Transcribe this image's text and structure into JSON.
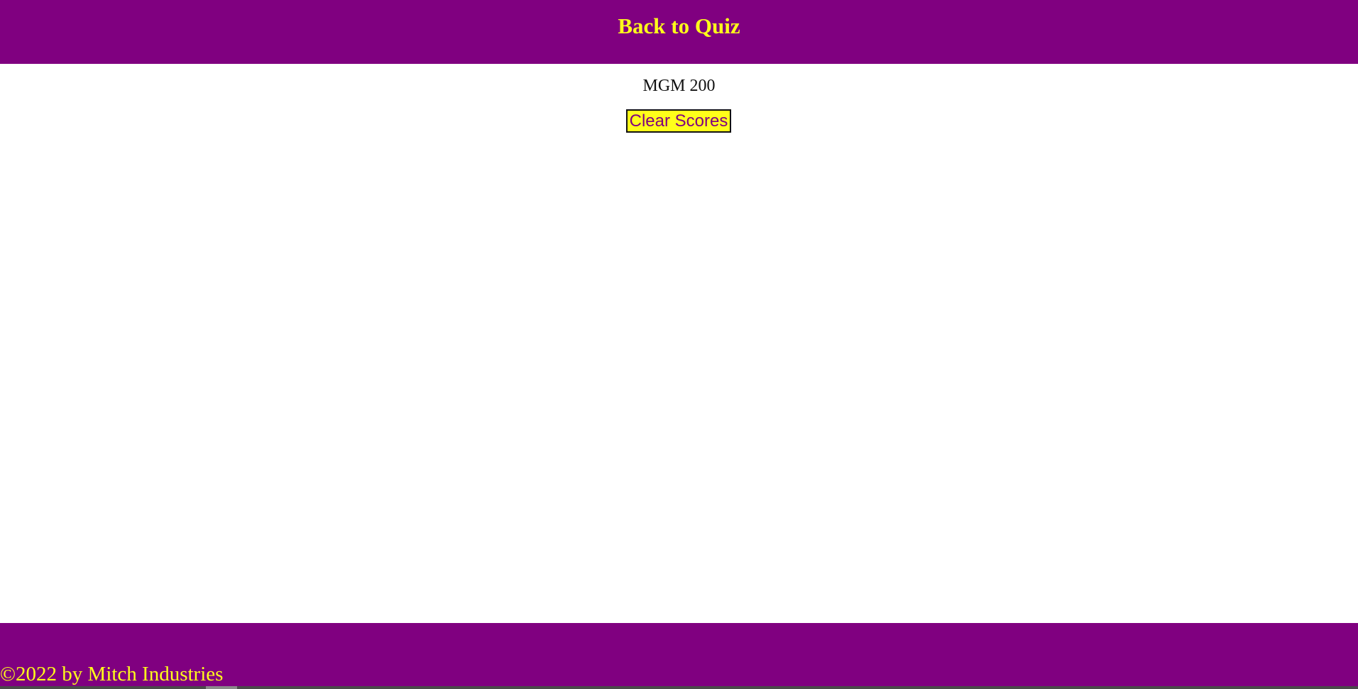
{
  "header": {
    "link_label": "Back to Quiz"
  },
  "main": {
    "score_entry": "MGM 200",
    "clear_button_label": "Clear Scores"
  },
  "footer": {
    "copyright": "©2022 by Mitch Industries"
  },
  "colors": {
    "brand_purple": "#800080",
    "accent_yellow": "#ffff1a",
    "background": "#ffffff"
  }
}
